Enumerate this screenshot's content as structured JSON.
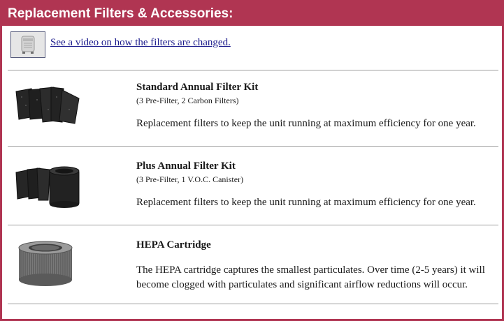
{
  "header": {
    "title": "Replacement Filters & Accessories:"
  },
  "video": {
    "link_text": "See a video on how the filters are changed.",
    "thumb_icon": "air-purifier-unit-icon"
  },
  "items": [
    {
      "title": "Standard Annual Filter Kit",
      "subtitle": "(3 Pre-Filter, 2 Carbon Filters)",
      "description": "Replacement filters to keep the unit running at maximum efficiency for one year.",
      "image": "standard-filter-kit-image"
    },
    {
      "title": "Plus Annual Filter Kit",
      "subtitle": "(3 Pre-Filter, 1 V.O.C. Canister)",
      "description": "Replacement filters to keep the unit running at maximum efficiency for one year.",
      "image": "plus-filter-kit-image"
    },
    {
      "title": "HEPA Cartridge",
      "subtitle": "",
      "description": "The HEPA cartridge captures the smallest particulates. Over time (2-5 years) it will become clogged with particulates and significant airflow reductions will occur.",
      "image": "hepa-cartridge-image"
    }
  ],
  "colors": {
    "brand": "#b03552",
    "link": "#1a1a8c",
    "divider": "#9e9e9e"
  }
}
